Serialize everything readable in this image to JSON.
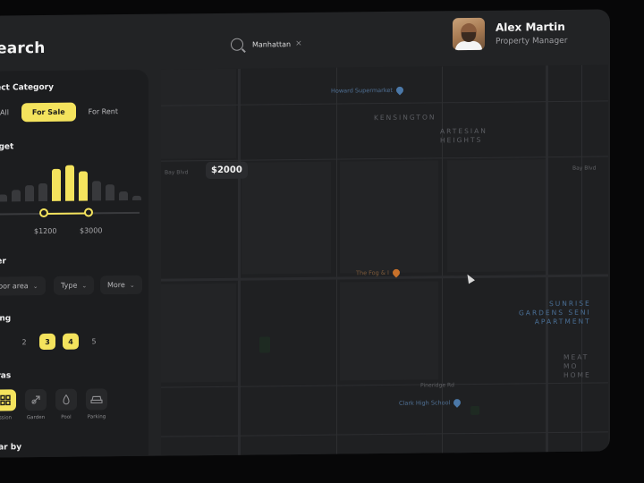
{
  "header": {
    "title": "earch",
    "search_chip": "Manhattan",
    "chip_close": "×",
    "user_name": "Alex Martin",
    "user_role": "Property Manager"
  },
  "sidebar": {
    "category_title": "lect Category",
    "category_tabs": [
      {
        "label": "All",
        "active": false
      },
      {
        "label": "For Sale",
        "active": true
      },
      {
        "label": "For Rent",
        "active": false
      }
    ],
    "budget_title": "dget",
    "budget_histogram": [
      0.2,
      0.32,
      0.45,
      0.5,
      0.9,
      1.0,
      0.82,
      0.55,
      0.45,
      0.25,
      0.12
    ],
    "budget_selected_range": [
      4,
      6
    ],
    "price_min": "$1200",
    "price_max": "$3000",
    "filter_title": "ter",
    "filters": [
      {
        "label": "loor area",
        "chevron": "⌄"
      },
      {
        "label": "Type",
        "chevron": "⌄"
      },
      {
        "label": "More",
        "chevron": "⌄"
      }
    ],
    "rating_title": "ting",
    "ratings": [
      {
        "label": "",
        "active": false
      },
      {
        "label": "2",
        "active": false
      },
      {
        "label": "3",
        "active": true
      },
      {
        "label": "4",
        "active": true
      },
      {
        "label": "5",
        "active": false
      }
    ],
    "extras_title": "tras",
    "extras": [
      {
        "label": "ssion",
        "icon": "grid-icon",
        "active": true
      },
      {
        "label": "Garden",
        "icon": "garden-icon",
        "active": false
      },
      {
        "label": "Pool",
        "icon": "pool-icon",
        "active": false
      },
      {
        "label": "Parking",
        "icon": "car-icon",
        "active": false
      }
    ],
    "near_title": "ear by"
  },
  "map": {
    "price_marker": "$2000",
    "areas": {
      "kensington": "KENSINGTON",
      "artesian": "ARTESIAN\nHEIGHTS",
      "sunrise": "SUNRISE\nGARDENS SENI\nAPARTMENT",
      "meadow": "MEAT\nMO\nHOME"
    },
    "pois": {
      "poi1": "Howard Supermarket",
      "poi2": "The Fog & I",
      "poi3": "Clark High School"
    },
    "streets": {
      "s1": "Bay Blvd",
      "s2": "Bay Blvd",
      "s3": "Pineridge Rd"
    }
  }
}
